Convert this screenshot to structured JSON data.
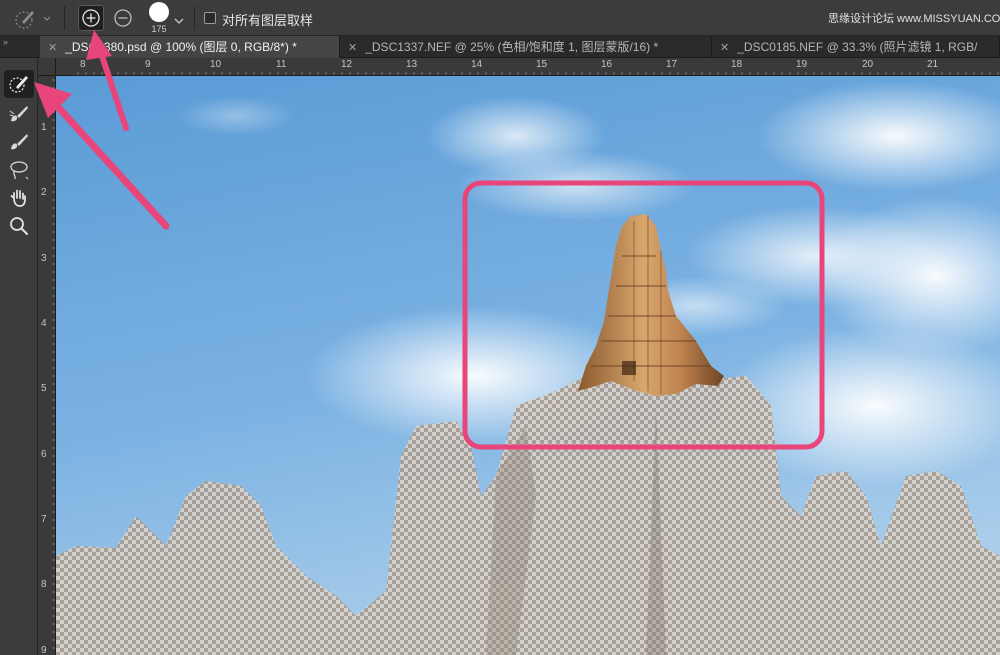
{
  "options_bar": {
    "brush_size": "175",
    "sample_all_layers_label": "对所有图层取样",
    "sample_all_layers_checked": false,
    "mode_add_icon": "plus-circle-icon",
    "mode_subtract_icon": "minus-circle-icon"
  },
  "watermark": "思缘设计论坛 www.MISSYUAN.COM",
  "tabs": [
    {
      "label": "_DSC1380.psd @ 100% (图层 0, RGB/8*) *",
      "active": true
    },
    {
      "label": "_DSC1337.NEF @ 25% (色相/饱和度 1, 图层蒙版/16) *",
      "active": false
    },
    {
      "label": "_DSC0185.NEF @ 33.3% (照片滤镜 1, RGB/",
      "active": false
    }
  ],
  "toolbar": [
    {
      "name": "quick-selection-tool",
      "icon": "quick-selection-brush-icon",
      "active": true
    },
    {
      "name": "refine-edge-brush-tool",
      "icon": "refine-edge-brush-icon",
      "active": false
    },
    {
      "name": "brush-tool",
      "icon": "paint-brush-icon",
      "active": false
    },
    {
      "name": "lasso-tool",
      "icon": "lasso-icon",
      "active": false
    },
    {
      "name": "hand-tool",
      "icon": "hand-icon",
      "active": false
    },
    {
      "name": "zoom-tool",
      "icon": "magnifier-icon",
      "active": false
    }
  ],
  "ruler_h": [
    "8",
    "9",
    "10",
    "11",
    "12",
    "13",
    "14",
    "15",
    "16",
    "17",
    "18",
    "19",
    "20",
    "21"
  ],
  "ruler_v": [
    "1",
    "2",
    "3",
    "4",
    "5",
    "6",
    "7",
    "8",
    "9"
  ],
  "colors": {
    "panel": "#3c3c3c",
    "highlight": "#e8457a",
    "sky_top": "#5f9fd9",
    "sky_bottom": "#9ec8ea",
    "stone": "#c9955c"
  }
}
